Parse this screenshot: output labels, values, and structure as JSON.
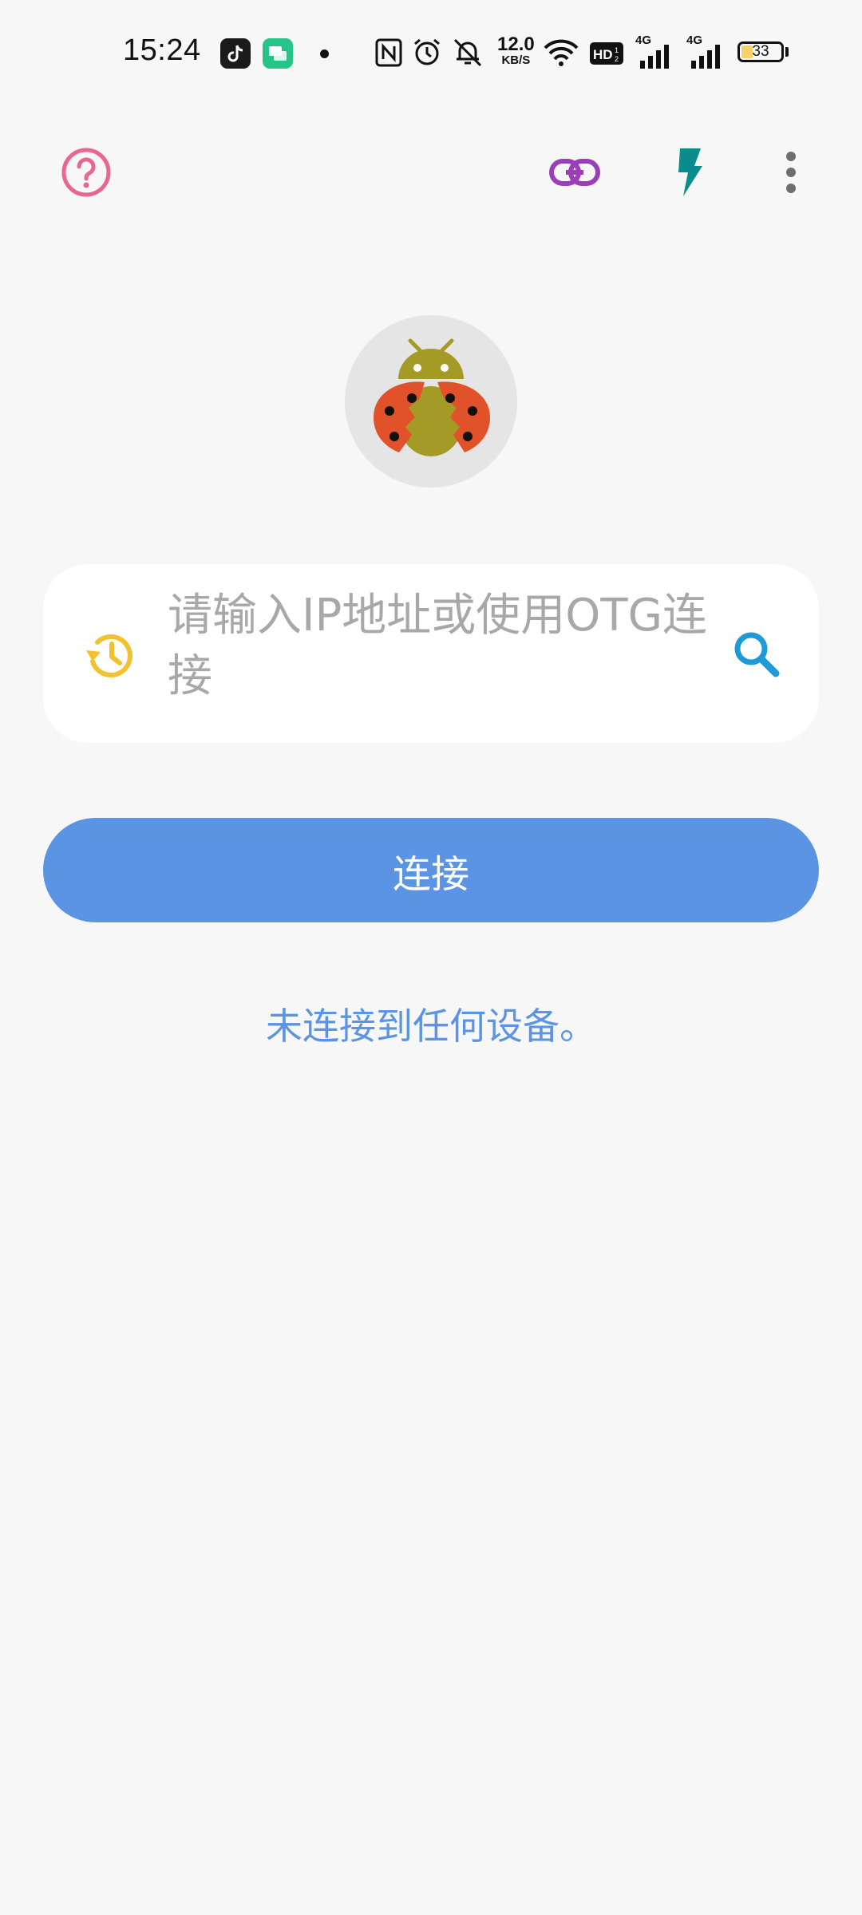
{
  "status_bar": {
    "time": "15:24",
    "net_speed_value": "12.0",
    "net_speed_unit": "KB/S",
    "network_1": "4G",
    "network_2": "4G",
    "battery_level": "33",
    "icons": [
      "tiktok-app-icon",
      "messages-app-icon",
      "notification-dot-icon",
      "nfc-icon",
      "alarm-icon",
      "mute-icon",
      "wifi-icon",
      "hd-icon",
      "signal-icon",
      "signal-icon",
      "battery-icon"
    ]
  },
  "toolbar": {
    "icons": [
      "help-icon",
      "link-icon",
      "flash-icon",
      "more-vert-icon"
    ],
    "colors": {
      "help": "#e8678f",
      "link": "#9b3fb6",
      "flash": "#0b8c8c",
      "more": "#6e6e6e"
    }
  },
  "logo": {
    "icon": "android-ladybug-icon"
  },
  "connect_form": {
    "placeholder": "请输入IP地址或使用OTG连接",
    "value": "",
    "history_icon": "history-icon",
    "search_icon": "search-icon",
    "connect_label": "连接"
  },
  "status_message": "未连接到任何设备。",
  "colors": {
    "accent": "#5b94e3",
    "background": "#f7f7f7",
    "history_icon": "#f2c12e",
    "search_icon": "#1e9ad6"
  }
}
